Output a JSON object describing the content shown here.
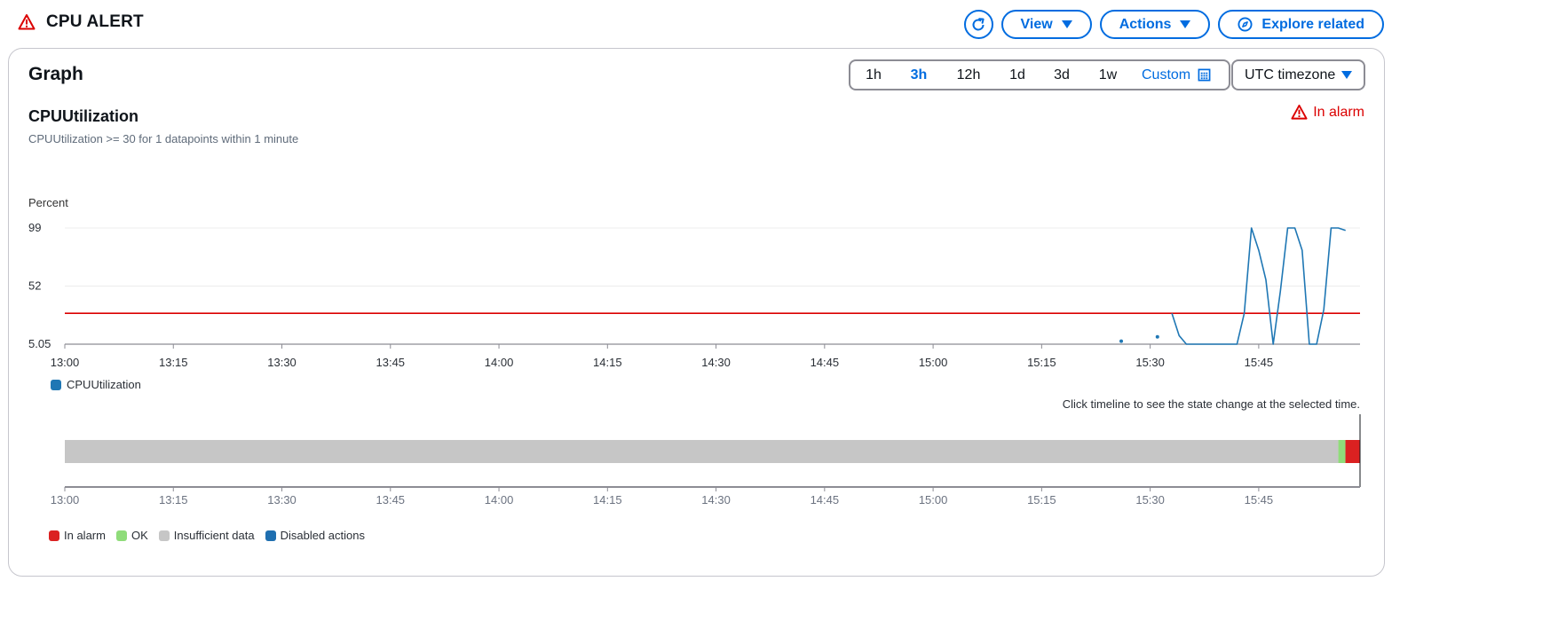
{
  "header": {
    "title": "CPU ALERT",
    "buttons": {
      "view": "View",
      "actions": "Actions",
      "explore": "Explore related"
    }
  },
  "panel": {
    "title": "Graph",
    "time_ranges": [
      "1h",
      "3h",
      "12h",
      "1d",
      "3d",
      "1w"
    ],
    "selected_range": "3h",
    "custom_label": "Custom",
    "timezone": "UTC timezone"
  },
  "metric": {
    "title": "CPUUtilization",
    "condition": "CPUUtilization >= 30 for 1 datapoints within 1 minute",
    "state": "In alarm"
  },
  "chart_data": {
    "type": "line",
    "ylabel": "Percent",
    "ylim": [
      5.05,
      99
    ],
    "y_ticks": [
      "99",
      "52",
      "5.05"
    ],
    "x_ticks": [
      "13:00",
      "13:15",
      "13:30",
      "13:45",
      "14:00",
      "14:15",
      "14:30",
      "14:45",
      "15:00",
      "15:15",
      "15:30",
      "15:45"
    ],
    "x_range": [
      "13:00",
      "15:59"
    ],
    "threshold": 30,
    "threshold_color": "#db0000",
    "series": [
      {
        "name": "CPUUtilization",
        "color": "#1f77b4",
        "points": [
          [
            "15:26",
            7.5
          ],
          [
            "15:31",
            11
          ],
          [
            "15:33",
            30
          ],
          [
            "15:34",
            12
          ],
          [
            "15:35",
            5.05
          ],
          [
            "15:36",
            5.05
          ],
          [
            "15:37",
            5.05
          ],
          [
            "15:38",
            5.05
          ],
          [
            "15:39",
            5.05
          ],
          [
            "15:40",
            5.05
          ],
          [
            "15:41",
            5.05
          ],
          [
            "15:42",
            5.05
          ],
          [
            "15:43",
            30
          ],
          [
            "15:44",
            99
          ],
          [
            "15:45",
            81
          ],
          [
            "15:46",
            57
          ],
          [
            "15:47",
            5.05
          ],
          [
            "15:48",
            48
          ],
          [
            "15:49",
            99
          ],
          [
            "15:50",
            99
          ],
          [
            "15:51",
            81
          ],
          [
            "15:52",
            5.05
          ],
          [
            "15:53",
            5.05
          ],
          [
            "15:54",
            33
          ],
          [
            "15:55",
            99
          ],
          [
            "15:56",
            99
          ],
          [
            "15:57",
            97
          ]
        ],
        "isolated_points": [
          "15:26",
          "15:31"
        ]
      }
    ]
  },
  "timeline": {
    "hint": "Click timeline to see the state change at the selected time.",
    "states": [
      {
        "state": "Insufficient data",
        "from": "13:00",
        "to": "15:56",
        "color": "#c6c6c6"
      },
      {
        "state": "OK",
        "from": "15:56",
        "to": "15:56",
        "color": "#8fdc7a"
      },
      {
        "state": "In alarm",
        "from": "15:56",
        "to": "15:59",
        "color": "#db2121"
      }
    ],
    "legend": [
      {
        "label": "In alarm",
        "color": "#db2121"
      },
      {
        "label": "OK",
        "color": "#8fdc7a"
      },
      {
        "label": "Insufficient data",
        "color": "#c6c6c6"
      },
      {
        "label": "Disabled actions",
        "color": "#1f6fb0"
      }
    ]
  }
}
